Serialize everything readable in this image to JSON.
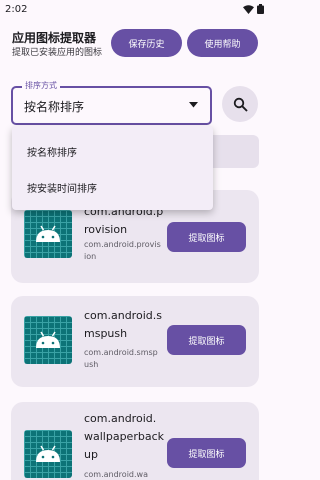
{
  "status_bar": {
    "time": "2:02"
  },
  "header": {
    "title": "应用图标提取器",
    "subtitle": "提取已安装应用的图标",
    "history_button": "保存历史",
    "help_button": "使用帮助"
  },
  "sort": {
    "label": "排序方式",
    "value": "按名称排序",
    "options": [
      "按名称排序",
      "按安装时间排序"
    ]
  },
  "apps": [
    {
      "name": "com.android.provision",
      "package": "com.android.provision",
      "action": "提取图标"
    },
    {
      "name": "com.android.smspush",
      "package": "com.android.smspush",
      "action": "提取图标"
    },
    {
      "name": "com.android.wallpaperbackup",
      "package": "com.android.wa",
      "action": "提取图标"
    }
  ],
  "colors": {
    "primary": "#6750a4",
    "surface": "#fdf8fd",
    "card": "#ece6f0",
    "icon_bg": "#0d7377"
  },
  "icons": [
    "wifi-icon",
    "battery-icon",
    "search-icon",
    "dropdown-arrow-icon",
    "android-icon"
  ]
}
